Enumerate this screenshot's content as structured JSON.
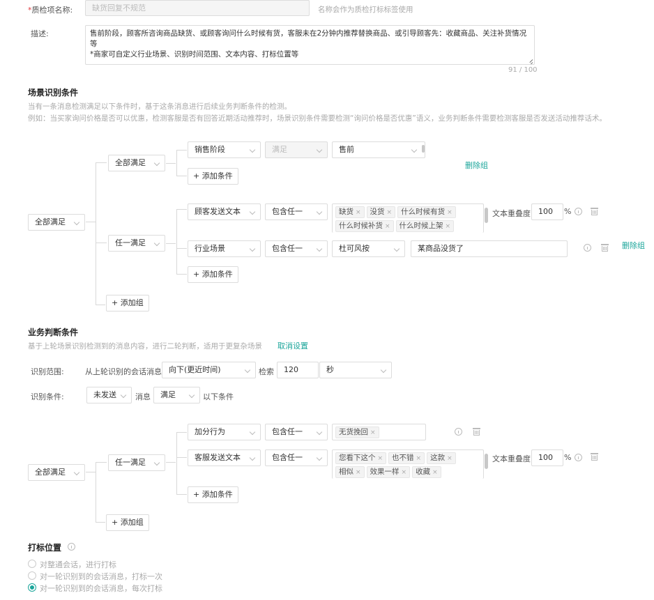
{
  "form": {
    "name_label_required": "*",
    "name_label": "质检项名称:",
    "name_placeholder": "缺货回复不规范",
    "name_hint": "名称会作为质检打标标签使用",
    "desc_label": "描述:",
    "desc_line1": "售前阶段，顾客所咨询商品缺货、或顾客询问什么时候有货，客服未在2分钟内推荐替换商品、或引导顾客先：收藏商品、关注补货情况",
    "desc_line2": "等",
    "desc_line3": "*商家可自定义行业场景、识别时间范围、文本内容、打标位置等",
    "desc_counter": "91 / 100"
  },
  "scene": {
    "title": "场景识别条件",
    "desc1": "当有一条消息检测满足以下条件时，基于这条消息进行后续业务判断条件的检测。",
    "desc2": "例如：当买家询问价格是否可以优惠，检测客服是否有回答近期活动推荐时，场景识别条件需要检测“询问价格是否优惠”语义，业务判断条件需要检测客服是否发送活动推荐话术。",
    "root_logic": "全部满足",
    "group1": {
      "logic": "全部满足",
      "cond1": {
        "field": "销售阶段",
        "op": "满足",
        "value": "售前"
      },
      "add_condition": "+ 添加条件",
      "delete_group": "删除组"
    },
    "group2": {
      "logic": "任一满足",
      "cond1": {
        "field": "顾客发送文本",
        "op": "包含任一",
        "tags": [
          "缺货",
          "没货",
          "什么时候有货",
          "什么时候补货",
          "什么时候上架"
        ],
        "overlap_label": "文本重叠度",
        "overlap_value": "100",
        "overlap_unit": "%"
      },
      "cond2": {
        "field": "行业场景",
        "op": "包含任一",
        "industry": "杜可风按",
        "text": "某商品没货了"
      },
      "add_condition": "+ 添加条件",
      "delete_group": "删除组"
    },
    "add_group": "+ 添加组"
  },
  "business": {
    "title": "业务判断条件",
    "desc": "基于上轮场景识别检测到的消息内容，进行二轮判断，适用于更复杂场景",
    "cancel_link": "取消设置",
    "range_label": "识别范围:",
    "range_prefix": "从上轮识别的会话消息",
    "range_direction": "向下(更近时间)",
    "range_search": "检索",
    "range_value": "120",
    "range_unit": "秒",
    "cond_label": "识别条件:",
    "cond_send": "未发送",
    "cond_msg": "消息",
    "cond_match": "满足",
    "cond_suffix": "以下条件",
    "root_logic": "全部满足",
    "group1": {
      "logic": "任一满足",
      "cond1": {
        "field": "加分行为",
        "op": "包含任一",
        "tags": [
          "无货挽回"
        ]
      },
      "cond2": {
        "field": "客服发送文本",
        "op": "包含任一",
        "tags": [
          "您看下这个",
          "也不错",
          "这款",
          "相似",
          "效果一样",
          "收藏"
        ],
        "overlap_label": "文本重叠度",
        "overlap_value": "100",
        "overlap_unit": "%"
      },
      "add_condition": "+ 添加条件"
    },
    "add_group": "+ 添加组"
  },
  "marking": {
    "title": "打标位置",
    "options": [
      {
        "label": "对整通会话，进行打标",
        "selected": false
      },
      {
        "label": "对一轮识别到的会话消息，打标一次",
        "selected": false
      },
      {
        "label": "对一轮识别到的会话消息，每次打标",
        "selected": true
      }
    ]
  },
  "colors": {
    "accent": "#1aa59a",
    "required": "#e0393e"
  }
}
